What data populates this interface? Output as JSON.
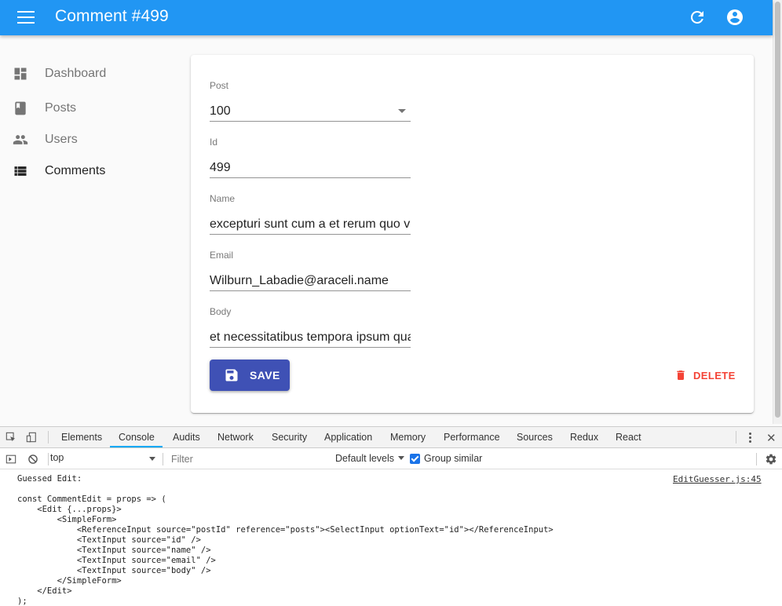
{
  "appbar": {
    "title": "Comment #499",
    "menu_icon": "menu-icon",
    "refresh_icon": "refresh-icon",
    "account_icon": "account-circle-icon",
    "color": "#2196f3"
  },
  "sidebar": {
    "items": [
      {
        "label": "Dashboard",
        "icon": "dashboard-icon"
      },
      {
        "label": "Posts",
        "icon": "book-icon"
      },
      {
        "label": "Users",
        "icon": "people-icon"
      },
      {
        "label": "Comments",
        "icon": "list-icon"
      }
    ]
  },
  "form": {
    "post": {
      "label": "Post",
      "value": "100"
    },
    "id": {
      "label": "Id",
      "value": "499"
    },
    "name": {
      "label": "Name",
      "value": "excepturi sunt cum a et rerum quo voluptatibus quia"
    },
    "email": {
      "label": "Email",
      "value": "Wilburn_Labadie@araceli.name"
    },
    "body": {
      "label": "Body",
      "value": "et necessitatibus tempora ipsum quaerat inventore est quasi quidem"
    },
    "save_label": "SAVE",
    "delete_label": "DELETE",
    "save_color": "#3f51b5",
    "delete_color": "#f44336"
  },
  "devtools": {
    "tabs": [
      "Elements",
      "Console",
      "Audits",
      "Network",
      "Security",
      "Application",
      "Memory",
      "Performance",
      "Sources",
      "Redux",
      "React"
    ],
    "active_tab": "Console",
    "context": "top",
    "filter_placeholder": "Filter",
    "levels": "Default levels",
    "group_similar": "Group similar",
    "group_similar_checked": true
  },
  "console": {
    "message": "Guessed Edit:",
    "source": "EditGuesser.js:45",
    "code": "const CommentEdit = props => (\n    <Edit {...props}>\n        <SimpleForm>\n            <ReferenceInput source=\"postId\" reference=\"posts\"><SelectInput optionText=\"id\"></ReferenceInput>\n            <TextInput source=\"id\" />\n            <TextInput source=\"name\" />\n            <TextInput source=\"email\" />\n            <TextInput source=\"body\" />\n        </SimpleForm>\n    </Edit>\n);"
  }
}
